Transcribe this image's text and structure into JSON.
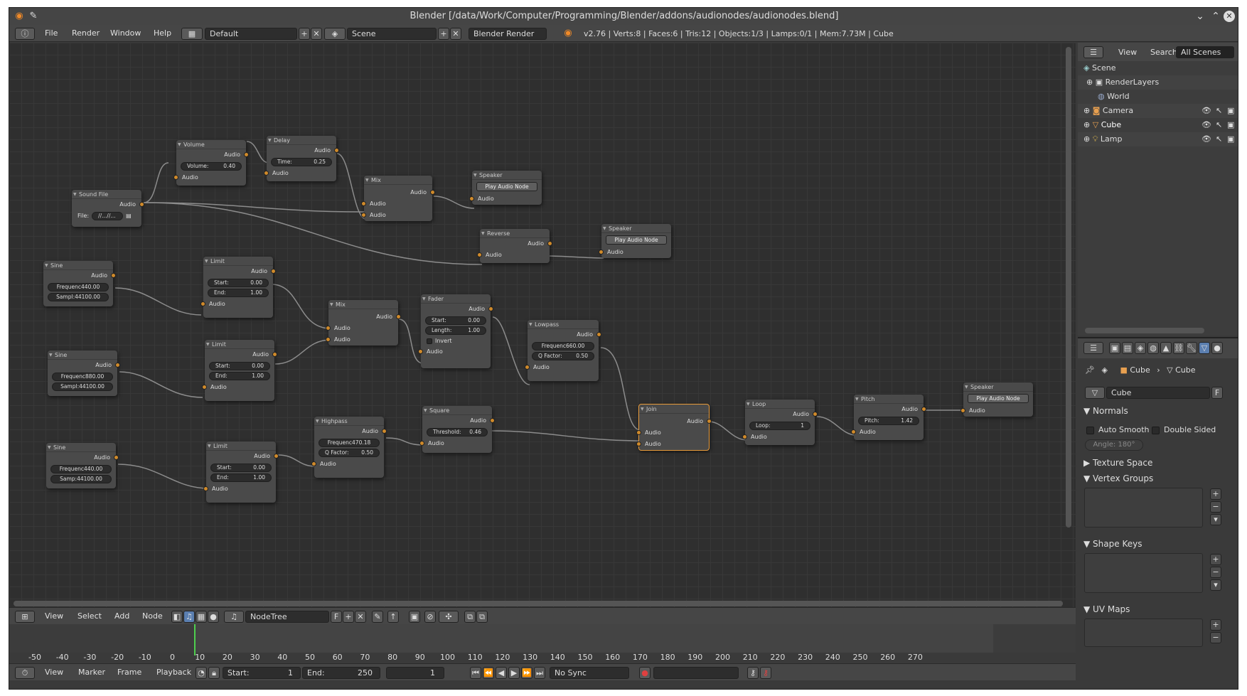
{
  "window": {
    "title": "Blender [/data/Work/Computer/Programming/Blender/addons/audionodes/audionodes.blend]"
  },
  "infobar": {
    "menus": [
      "File",
      "Render",
      "Window",
      "Help"
    ],
    "screen_layout": "Default",
    "scene": "Scene",
    "render_engine": "Blender Render",
    "stats": "v2.76 | Verts:8 | Faces:6 | Tris:12 | Objects:1/3 | Lamps:0/1 | Mem:7.73M | Cube"
  },
  "nodes": {
    "sound_file": {
      "title": "Sound File",
      "out": "Audio",
      "file_label": "File:",
      "file_value": "//...//..."
    },
    "volume": {
      "title": "Volume",
      "out": "Audio",
      "field": "Volume:",
      "value": "0.40",
      "in": "Audio"
    },
    "delay": {
      "title": "Delay",
      "out": "Audio",
      "field": "Time:",
      "value": "0.25",
      "in": "Audio"
    },
    "mix1": {
      "title": "Mix",
      "out": "Audio",
      "in1": "Audio",
      "in2": "Audio"
    },
    "speaker1": {
      "title": "Speaker",
      "button": "Play Audio Node",
      "in": "Audio"
    },
    "reverse": {
      "title": "Reverse",
      "out": "Audio",
      "in": "Audio"
    },
    "speaker2": {
      "title": "Speaker",
      "button": "Play Audio Node",
      "in": "Audio"
    },
    "sine1": {
      "title": "Sine",
      "out": "Audio",
      "f1": "Frequenc440.00",
      "f2": "Sampl:44100.00"
    },
    "limit1": {
      "title": "Limit",
      "out": "Audio",
      "start_label": "Start:",
      "start": "0.00",
      "end_label": "End:",
      "end": "1.00",
      "in": "Audio"
    },
    "mix2": {
      "title": "Mix",
      "out": "Audio",
      "in1": "Audio",
      "in2": "Audio"
    },
    "fader": {
      "title": "Fader",
      "out": "Audio",
      "start_label": "Start:",
      "start": "0.00",
      "length_label": "Length:",
      "length": "1.00",
      "invert": "Invert",
      "in": "Audio"
    },
    "lowpass": {
      "title": "Lowpass",
      "out": "Audio",
      "f1": "Frequenc660.00",
      "q_label": "Q Factor:",
      "q": "0.50",
      "in": "Audio"
    },
    "sine2": {
      "title": "Sine",
      "out": "Audio",
      "f1": "Frequenc880.00",
      "f2": "Sampl:44100.00"
    },
    "limit2": {
      "title": "Limit",
      "out": "Audio",
      "start_label": "Start:",
      "start": "0.00",
      "end_label": "End:",
      "end": "1.00",
      "in": "Audio"
    },
    "square": {
      "title": "Square",
      "out": "Audio",
      "th_label": "Threshold:",
      "th": "0.46",
      "in": "Audio"
    },
    "join": {
      "title": "Join",
      "out": "Audio",
      "in1": "Audio",
      "in2": "Audio"
    },
    "loop": {
      "title": "Loop",
      "out": "Audio",
      "loop_label": "Loop:",
      "loop": "1",
      "in": "Audio"
    },
    "pitch": {
      "title": "Pitch",
      "out": "Audio",
      "pitch_label": "Pitch:",
      "pitch": "1.42",
      "in": "Audio"
    },
    "speaker3": {
      "title": "Speaker",
      "button": "Play Audio Node",
      "in": "Audio"
    },
    "sine3": {
      "title": "Sine",
      "out": "Audio",
      "f1": "Frequenc440.00",
      "f2": "Samp:44100.00"
    },
    "limit3": {
      "title": "Limit",
      "out": "Audio",
      "start_label": "Start:",
      "start": "0.00",
      "end_label": "End:",
      "end": "1.00",
      "in": "Audio"
    },
    "highpass": {
      "title": "Highpass",
      "out": "Audio",
      "f1": "Frequenc470.18",
      "q_label": "Q Factor:",
      "q": "0.50",
      "in": "Audio"
    }
  },
  "node_editor_header": {
    "menus": [
      "View",
      "Select",
      "Add",
      "Node"
    ],
    "tree": "NodeTree",
    "fake_user": "F"
  },
  "timeline": {
    "ticks": [
      "-50",
      "-40",
      "-30",
      "-20",
      "-10",
      "0",
      "10",
      "20",
      "30",
      "40",
      "50",
      "60",
      "70",
      "80",
      "90",
      "100",
      "110",
      "120",
      "130",
      "140",
      "150",
      "160",
      "170",
      "180",
      "190",
      "200",
      "210",
      "220",
      "230",
      "240",
      "250",
      "260",
      "270"
    ],
    "menus": [
      "View",
      "Marker",
      "Frame",
      "Playback"
    ],
    "start_label": "Start:",
    "start": "1",
    "end_label": "End:",
    "end": "250",
    "current": "1",
    "sync": "No Sync"
  },
  "outliner": {
    "menus": [
      "View",
      "Search"
    ],
    "filter": "All Scenes",
    "items": [
      "Scene",
      "RenderLayers",
      "World",
      "Camera",
      "Cube",
      "Lamp"
    ]
  },
  "properties": {
    "breadcrumb1": "Cube",
    "breadcrumb2": "Cube",
    "mesh_name": "Cube",
    "fake_user": "F",
    "panels": {
      "normals": "Normals",
      "auto_smooth": "Auto Smooth",
      "double_sided": "Double Sided",
      "angle": "Angle: 180°",
      "texture_space": "Texture Space",
      "vertex_groups": "Vertex Groups",
      "shape_keys": "Shape Keys",
      "uv_maps": "UV Maps"
    }
  },
  "colors": {
    "socket": "#d08a2a",
    "selected_node": "#e89b3a",
    "frame_cursor": "#4ece4e"
  }
}
